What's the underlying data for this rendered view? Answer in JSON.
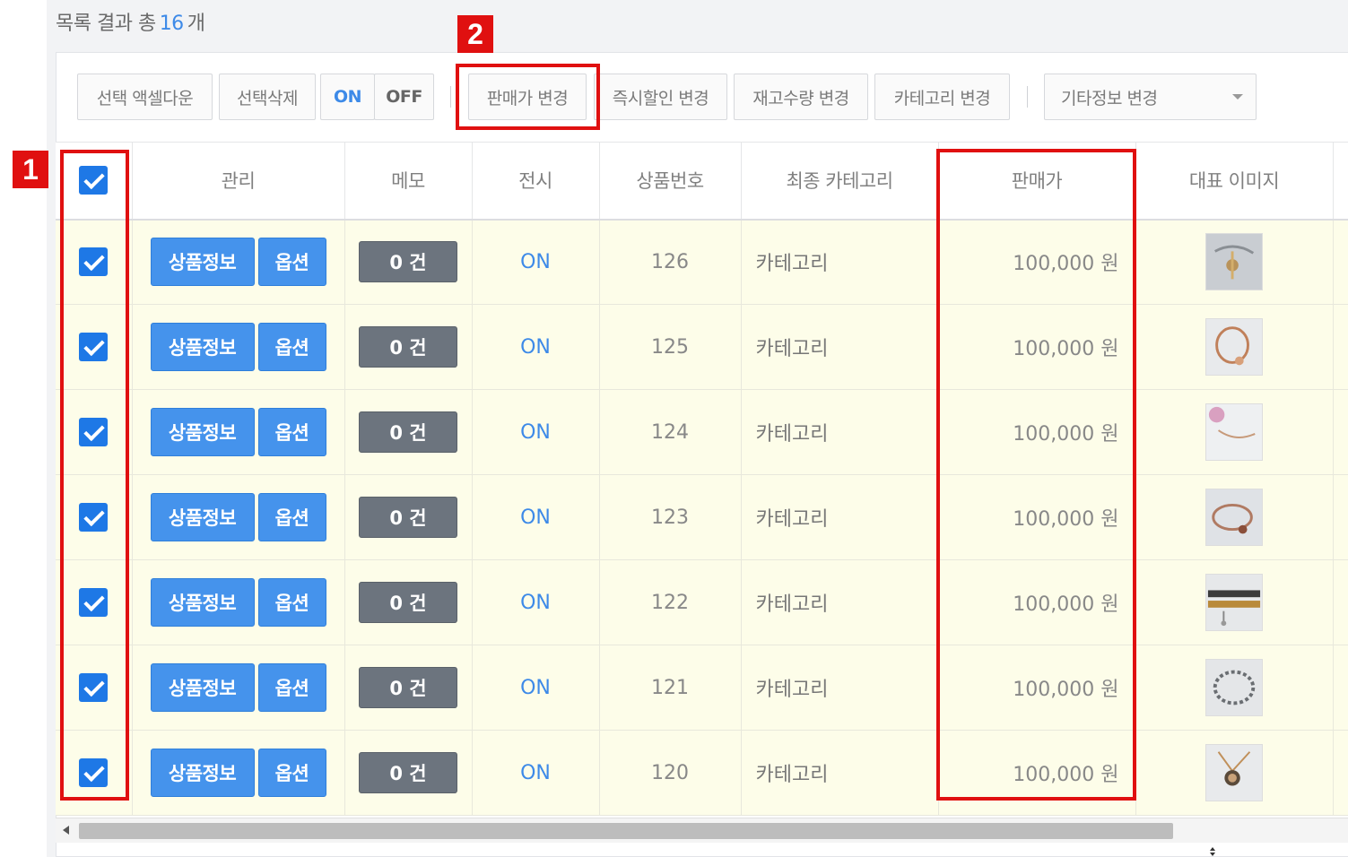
{
  "summary": {
    "prefix": "목록 결과 총",
    "count": "16",
    "suffix": "개"
  },
  "toolbar": {
    "excel_download": "선택 액셀다운",
    "delete_selected": "선택삭제",
    "on": "ON",
    "off": "OFF",
    "change_price": "판매가 변경",
    "change_discount": "즉시할인 변경",
    "change_stock": "재고수량 변경",
    "change_category": "카테고리 변경",
    "other_info_select": "기타정보 변경"
  },
  "columns": [
    "관리",
    "메모",
    "전시",
    "상품번호",
    "최종 카테고리",
    "판매가",
    "대표 이미지"
  ],
  "row_buttons": {
    "product_info": "상품정보",
    "option": "옵션"
  },
  "rows": [
    {
      "memo": "0 건",
      "display": "ON",
      "product_no": "126",
      "category": "카테고리",
      "price": "100,000 원",
      "image_icon": "jewelry-thumbnail"
    },
    {
      "memo": "0 건",
      "display": "ON",
      "product_no": "125",
      "category": "카테고리",
      "price": "100,000 원",
      "image_icon": "jewelry-thumbnail"
    },
    {
      "memo": "0 건",
      "display": "ON",
      "product_no": "124",
      "category": "카테고리",
      "price": "100,000 원",
      "image_icon": "jewelry-thumbnail"
    },
    {
      "memo": "0 건",
      "display": "ON",
      "product_no": "123",
      "category": "카테고리",
      "price": "100,000 원",
      "image_icon": "jewelry-thumbnail"
    },
    {
      "memo": "0 건",
      "display": "ON",
      "product_no": "122",
      "category": "카테고리",
      "price": "100,000 원",
      "image_icon": "jewelry-thumbnail"
    },
    {
      "memo": "0 건",
      "display": "ON",
      "product_no": "121",
      "category": "카테고리",
      "price": "100,000 원",
      "image_icon": "jewelry-thumbnail"
    },
    {
      "memo": "0 건",
      "display": "ON",
      "product_no": "120",
      "category": "카테고리",
      "price": "100,000 원",
      "image_icon": "jewelry-thumbnail"
    }
  ],
  "annotations": {
    "label_1": "1",
    "label_2": "2",
    "highlight_color": "#e01010"
  },
  "colors": {
    "accent": "#3d8ae8",
    "button_blue": "#4593ec",
    "memo_gray": "#6c747e",
    "row_bg": "#fdfde9"
  }
}
